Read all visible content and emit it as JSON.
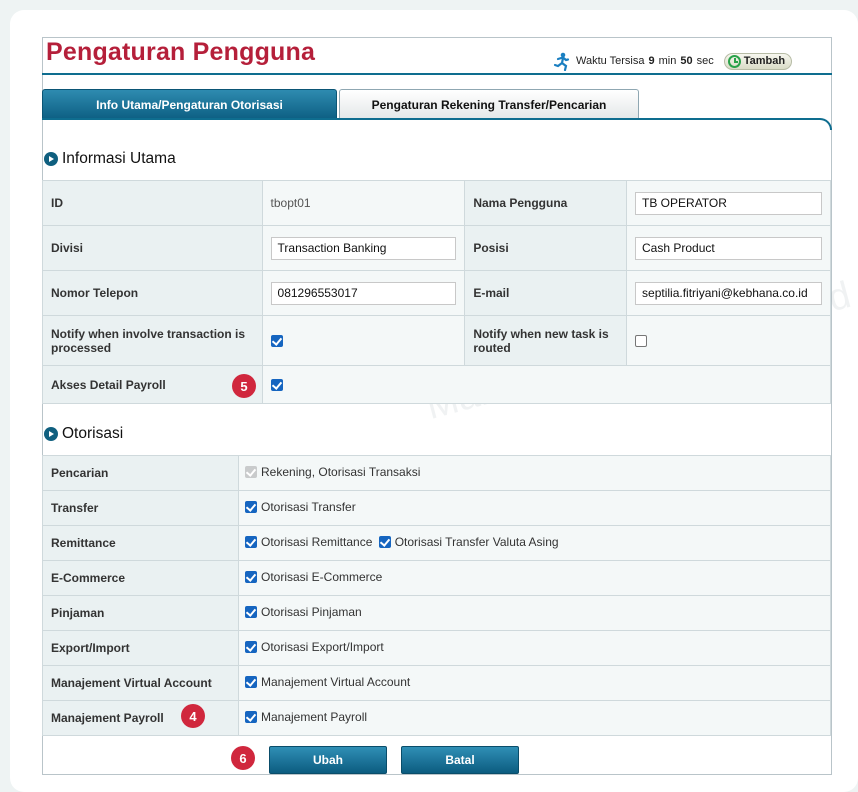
{
  "header": {
    "title": "Pengaturan Pengguna",
    "timer_prefix": "Waktu Tersisa",
    "timer_minutes": "9",
    "timer_min_label": "min",
    "timer_seconds": "50",
    "timer_sec_label": "sec",
    "add_label": "Tambah"
  },
  "tabs": [
    {
      "label": "Info Utama/Pengaturan Otorisasi",
      "active": true
    },
    {
      "label": "Pengaturan Rekening Transfer/Pencarian",
      "active": false
    }
  ],
  "info": {
    "section_title": "Informasi Utama",
    "id_label": "ID",
    "id_value": "tbopt01",
    "nama_label": "Nama Pengguna",
    "nama_value": "TB OPERATOR",
    "divisi_label": "Divisi",
    "divisi_value": "Transaction Banking",
    "posisi_label": "Posisi",
    "posisi_value": "Cash Product",
    "telepon_label": "Nomor Telepon",
    "telepon_value": "081296553017",
    "email_label": "E-mail",
    "email_value": "septilia.fitriyani@kebhana.co.id",
    "notify_processed_label": "Notify when involve transaction is processed",
    "notify_processed_checked": true,
    "notify_routed_label": "Notify when new task is routed",
    "notify_routed_checked": false,
    "payroll_label": "Akses Detail Payroll",
    "payroll_checked": true
  },
  "auth": {
    "section_title": "Otorisasi",
    "rows": [
      {
        "label": "Pencarian",
        "options": [
          "Rekening, Otorisasi Transaksi"
        ]
      },
      {
        "label": "Transfer",
        "options": [
          "Otorisasi Transfer"
        ]
      },
      {
        "label": "Remittance",
        "options": [
          "Otorisasi Remittance",
          "Otorisasi Transfer Valuta Asing"
        ]
      },
      {
        "label": "E-Commerce",
        "options": [
          "Otorisasi E-Commerce"
        ]
      },
      {
        "label": "Pinjaman",
        "options": [
          "Otorisasi Pinjaman"
        ]
      },
      {
        "label": "Export/Import",
        "options": [
          "Otorisasi Export/Import"
        ]
      },
      {
        "label": "Manajement Virtual Account",
        "options": [
          "Manajement Virtual Account"
        ]
      },
      {
        "label": "Manajement Payroll",
        "options": [
          "Manajement Payroll"
        ]
      }
    ]
  },
  "buttons": {
    "save": "Ubah",
    "cancel": "Batal"
  },
  "badges": {
    "step_payroll_access": "5",
    "step_payroll_mgmt": "4",
    "step_submit": "6"
  },
  "watermark": {
    "line1": "Management Product and",
    "line2": "10003733",
    "line3": "01-08"
  },
  "colors": {
    "title": "#b51f3a",
    "accent": "#0e6d8f",
    "badge": "#d0273d",
    "checkbox": "#1565c0"
  }
}
